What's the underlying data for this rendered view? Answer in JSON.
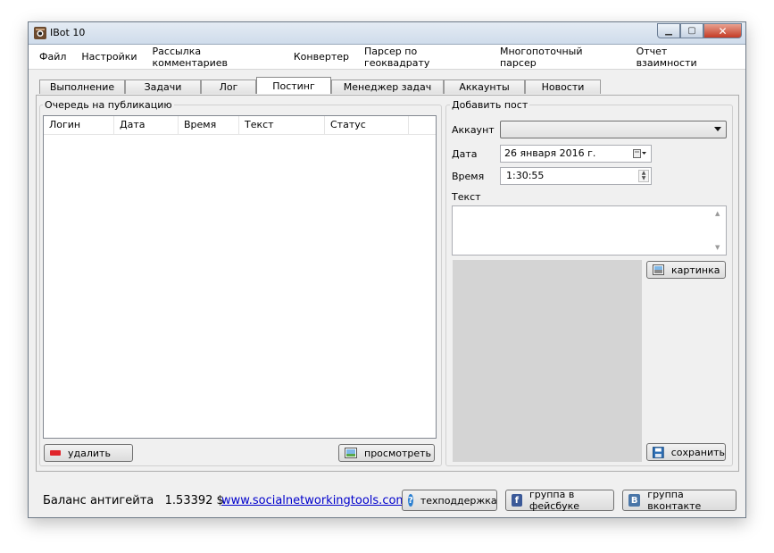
{
  "window": {
    "title": "IBot 10"
  },
  "menu": [
    "Файл",
    "Настройки",
    "Рассылка комментариев",
    "Конвертер",
    "Парсер по геоквадрату",
    "Многопоточный парсер",
    "Отчет взаимности"
  ],
  "tabs": [
    "Выполнение",
    "Задачи",
    "Лог",
    "Постинг",
    "Менеджер задач",
    "Аккаунты",
    "Новости"
  ],
  "queue": {
    "title": "Очередь на публикацию",
    "columns": [
      "Логин",
      "Дата",
      "Время",
      "Текст",
      "Статус"
    ],
    "delete_label": "удалить",
    "view_label": "просмотреть"
  },
  "post": {
    "title": "Добавить пост",
    "account_label": "Аккаунт",
    "account_value": "",
    "date_label": "Дата",
    "date_value": "26  января  2016 г.",
    "time_label": "Время",
    "time_value": "1:30:55",
    "text_label": "Текст",
    "picture_label": "картинка",
    "save_label": "сохранить"
  },
  "footer": {
    "balance_label": "Баланс антигейта",
    "balance_value": "1.53392 $",
    "link": "www.socialnetworkingtools.com.ua",
    "support_label": "техподдержка",
    "fb_label": "группа в фейсбуке",
    "vk_label": "группа вконтакте"
  },
  "colors": {
    "delete_icon": "#e0242a",
    "help_icon": "#2a7fd0",
    "fb_icon": "#3b5998",
    "vk_icon": "#4a76a8"
  }
}
